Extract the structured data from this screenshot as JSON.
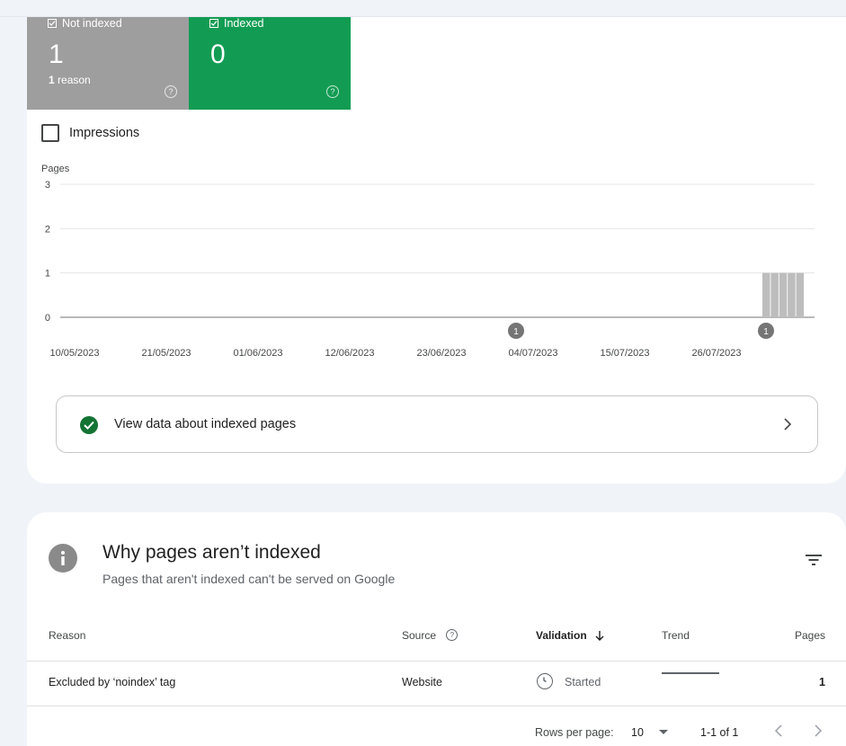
{
  "tiles": {
    "not_indexed": {
      "label": "Not indexed",
      "value": "1",
      "reasons_count": "1",
      "reasons_word": "reason",
      "color": "#9e9e9e"
    },
    "indexed": {
      "label": "Indexed",
      "value": "0",
      "color": "#129c53"
    }
  },
  "impressions_label": "Impressions",
  "chart_data": {
    "type": "bar",
    "ylabel": "Pages",
    "yticks": [
      "3",
      "2",
      "1",
      "0"
    ],
    "ylim": [
      0,
      3
    ],
    "xticks": [
      "10/05/2023",
      "21/05/2023",
      "01/06/2023",
      "12/06/2023",
      "23/06/2023",
      "04/07/2023",
      "15/07/2023",
      "26/07/2023"
    ],
    "bar_values": [
      1,
      1,
      1,
      1,
      1
    ],
    "annotations": [
      {
        "label": "1",
        "near": "04/07/2023"
      },
      {
        "label": "1",
        "near": "end"
      }
    ],
    "grid": true,
    "bar_color": "#bdbdbd"
  },
  "view_indexed": {
    "label": "View data about indexed pages"
  },
  "reasons_card": {
    "title": "Why pages aren’t indexed",
    "subtitle": "Pages that aren't indexed can't be served on Google",
    "columns": {
      "reason": "Reason",
      "source": "Source",
      "validation": "Validation",
      "trend": "Trend",
      "pages": "Pages"
    },
    "rows": [
      {
        "reason": "Excluded by ‘noindex’ tag",
        "source": "Website",
        "validation": "Started",
        "pages": "1"
      }
    ],
    "pager": {
      "rows_per_page_label": "Rows per page:",
      "rows_per_page": "10",
      "range": "1-1 of 1"
    }
  }
}
